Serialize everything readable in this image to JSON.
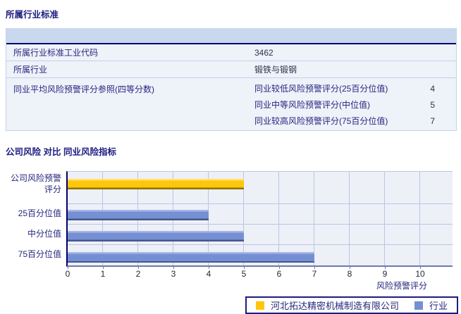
{
  "section1": {
    "title": "所属行业标准",
    "table": {
      "rows": [
        {
          "label": "所属行业标准工业代码",
          "value": "3462"
        },
        {
          "label": "所属行业",
          "value": "锻铁与锻钢"
        },
        {
          "label": "同业平均风险预警评分参照(四等分数)",
          "subrows": [
            {
              "label": "同业较低风险预警评分(25百分位值)",
              "value": "4"
            },
            {
              "label": "同业中等风险预警评分(中位值)",
              "value": "5"
            },
            {
              "label": "同业较高风险预警评分(75百分位值)",
              "value": "7"
            }
          ]
        }
      ]
    }
  },
  "section2": {
    "title": "公司风险 对比 同业风险指标"
  },
  "chart_data": {
    "type": "bar",
    "orientation": "horizontal",
    "title": "",
    "categories": [
      "公司风险预警评分",
      "25百分位值",
      "中分位值",
      "75百分位值"
    ],
    "series": [
      {
        "name": "河北拓达精密机械制造有限公司",
        "color": "#FFC60A",
        "color_light": "#FFE269",
        "color_dark": "#8F7200",
        "values": [
          5,
          null,
          null,
          null
        ]
      },
      {
        "name": "行业",
        "color": "#7590D2",
        "color_light": "#A7B7E6",
        "color_dark": "#46568F",
        "values": [
          null,
          4,
          5,
          7
        ]
      }
    ],
    "xlabel": "风险预警评分",
    "ylabel": "",
    "xlim": [
      0,
      10
    ],
    "xticks": [
      0,
      1,
      2,
      3,
      4,
      5,
      6,
      7,
      8,
      9,
      10
    ],
    "grid": true,
    "legend_position": "bottom"
  }
}
